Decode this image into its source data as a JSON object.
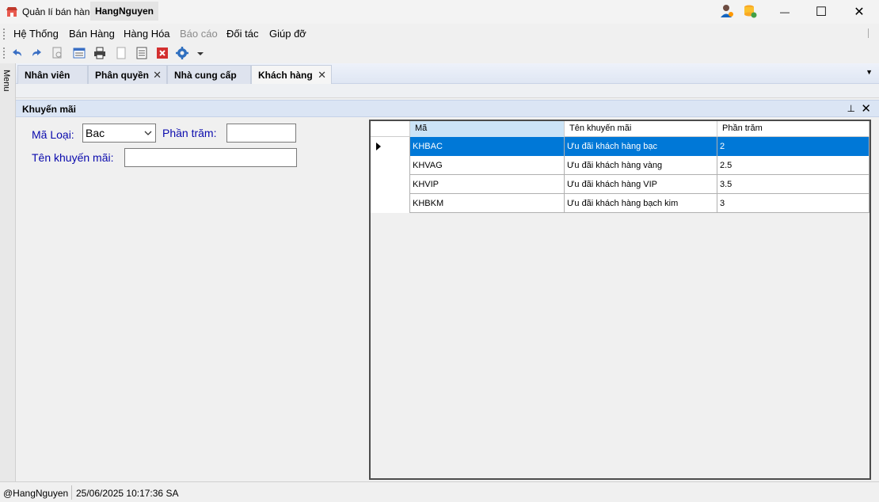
{
  "window": {
    "app_title": "Quản lí bán hàng",
    "user_tab": "HangNguyen",
    "controls": {
      "minimize": "—",
      "maximize": "☐",
      "close": "✕"
    }
  },
  "menu": [
    "Hệ Thống",
    "Bán Hàng",
    "Hàng Hóa",
    "Báo cáo",
    "Đối tác",
    "Giúp đỡ"
  ],
  "menu_disabled": [
    "Báo cáo"
  ],
  "toolbar_icons": [
    "undo-icon",
    "redo-icon",
    "preview-icon",
    "form-icon",
    "print-icon",
    "page-icon",
    "report-icon",
    "close-red-icon",
    "settings-icon",
    "dropdown-icon"
  ],
  "sidebar": {
    "label": "Menu"
  },
  "tabs": [
    {
      "label": "Nhân viên",
      "closable": false
    },
    {
      "label": "Phân quyền",
      "closable": true
    },
    {
      "label": "Nhà cung cấp",
      "closable": false
    },
    {
      "label": "Khách hàng",
      "closable": true,
      "active": true
    }
  ],
  "panel": {
    "title": "Khuyến mãi",
    "pin": "↕",
    "close": "✕"
  },
  "form": {
    "ma_loai_label": "Mã Loại:",
    "ma_loai_value": "Bac",
    "phan_tram_label": "Phần trăm:",
    "phan_tram_value": "",
    "ten_km_label": "Tên khuyến mãi:",
    "ten_km_value": ""
  },
  "grid": {
    "columns": [
      "Mã",
      "Tên khuyến mãi",
      "Phần trăm"
    ],
    "rows": [
      {
        "ma": "KHBAC",
        "ten": "Ưu đãi khách hàng bạc",
        "phan_tram": "2"
      },
      {
        "ma": "KHVAG",
        "ten": "Ưu đãi khách hàng vàng",
        "phan_tram": "2.5"
      },
      {
        "ma": "KHVIP",
        "ten": "Ưu đãi khách hàng VIP",
        "phan_tram": "3.5"
      },
      {
        "ma": "KHBKM",
        "ten": "Ưu đãi khách hàng bạch kim",
        "phan_tram": "3"
      }
    ],
    "selected_row": 0,
    "selection_color": "#0078d7"
  },
  "status": {
    "user": "@HangNguyen",
    "datetime": "25/06/2025 10:17:36 SA"
  }
}
